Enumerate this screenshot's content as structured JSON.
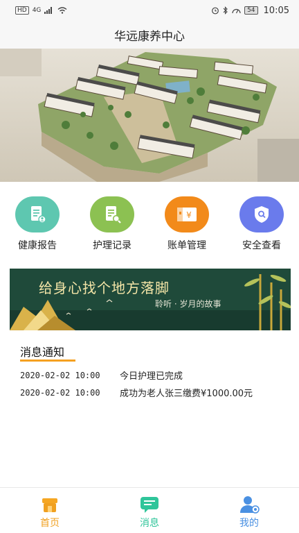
{
  "status_bar": {
    "hd": "HD",
    "network": "4G",
    "battery": "54",
    "time": "10:05"
  },
  "app": {
    "title": "华远康养中心"
  },
  "quick_actions": [
    {
      "label": "健康报告",
      "icon": "health-report-icon",
      "color": "#5ec7b0"
    },
    {
      "label": "护理记录",
      "icon": "care-record-icon",
      "color": "#8cc152"
    },
    {
      "label": "账单管理",
      "icon": "bill-icon",
      "color": "#f28a1a"
    },
    {
      "label": "安全查看",
      "icon": "shield-icon",
      "color": "#6a7bec"
    }
  ],
  "banner": {
    "title": "给身心找个地方落脚",
    "subtitle": "聆听 · 岁月的故事"
  },
  "messages": {
    "title": "消息通知",
    "items": [
      {
        "time": "2020-02-02 10:00",
        "text": "今日护理已完成"
      },
      {
        "time": "2020-02-02 10:00",
        "text": "成功为老人张三缴费¥1000.00元"
      }
    ]
  },
  "bottom_nav": [
    {
      "label": "首页",
      "icon": "home-store-icon",
      "color": "#f0a020"
    },
    {
      "label": "消息",
      "icon": "message-icon",
      "color": "#2fc59a"
    },
    {
      "label": "我的",
      "icon": "user-icon",
      "color": "#4a90e2"
    }
  ],
  "colors": {
    "accent": "#f5a020",
    "status_bg": "#f7f7f7"
  }
}
